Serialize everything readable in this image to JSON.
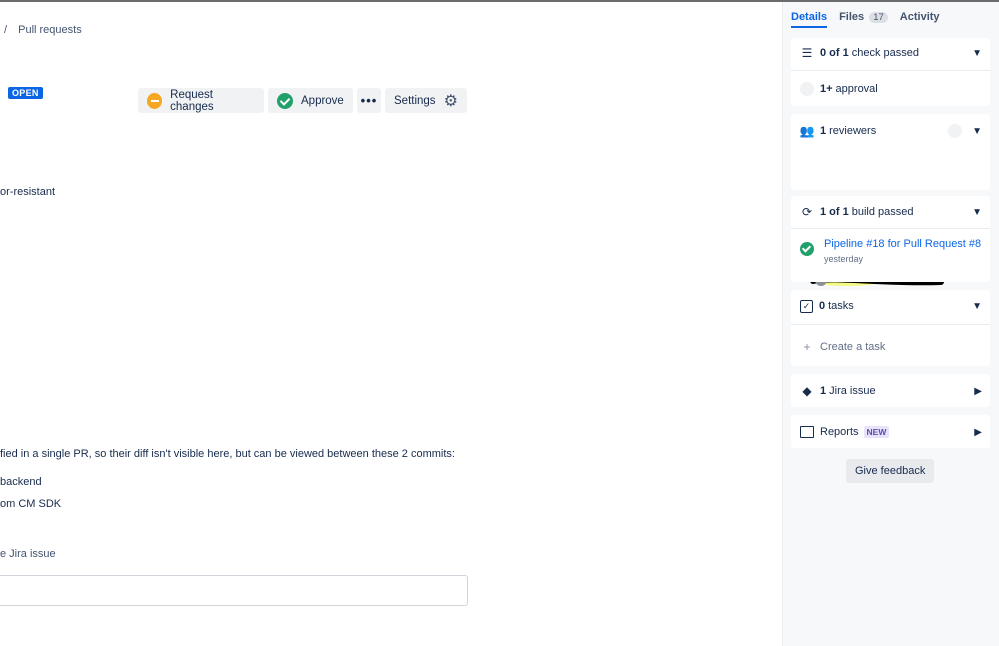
{
  "breadcrumb": {
    "separator": "/",
    "current": "Pull requests"
  },
  "status": {
    "label": "OPEN"
  },
  "actions": {
    "request_changes": "Request changes",
    "approve": "Approve",
    "more": "•••",
    "settings": "Settings"
  },
  "description": {
    "line1": "or-resistant",
    "line2": "fied in a single PR, so their diff isn't visible here, but can be viewed between these 2 commits:",
    "line3": "backend",
    "line4": "om CM SDK",
    "line5": "e Jira issue"
  },
  "sidebar": {
    "tabs": [
      {
        "label": "Details"
      },
      {
        "label": "Files",
        "count": "17"
      },
      {
        "label": "Activity"
      }
    ],
    "checks": {
      "bold": "0 of 1",
      "text": "check passed",
      "item_bold": "1+",
      "item_text": "approval"
    },
    "reviewers": {
      "bold": "1",
      "text": "reviewers"
    },
    "builds": {
      "bold": "1 of 1",
      "text": "build passed",
      "pipeline": "Pipeline #18 for Pull Request #8",
      "when": "yesterday"
    },
    "tasks": {
      "bold": "0",
      "text": "tasks",
      "create": "Create a task"
    },
    "jira": {
      "bold": "1",
      "text": "Jira issue"
    },
    "reports": {
      "text": "Reports",
      "badge": "NEW"
    },
    "feedback": "Give feedback"
  },
  "colors": {
    "accent": "#0c66e4",
    "success": "#22a06b",
    "warning": "#f5a623"
  }
}
